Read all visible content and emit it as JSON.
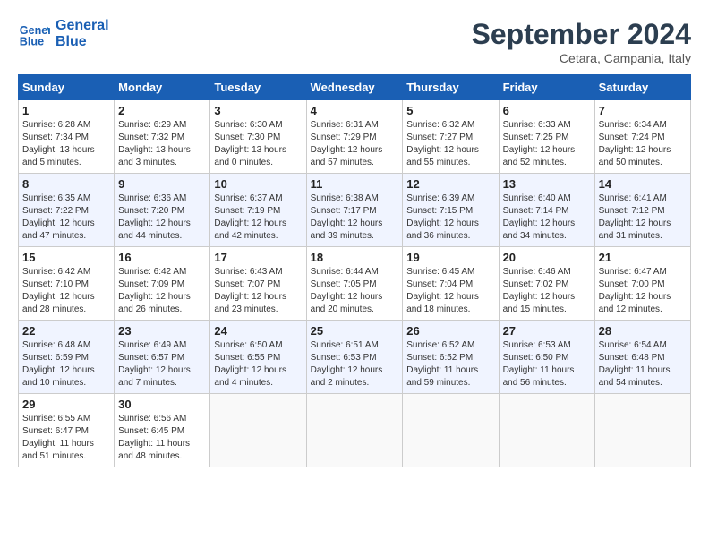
{
  "header": {
    "logo_line1": "General",
    "logo_line2": "Blue",
    "month_title": "September 2024",
    "subtitle": "Cetara, Campania, Italy"
  },
  "days_of_week": [
    "Sunday",
    "Monday",
    "Tuesday",
    "Wednesday",
    "Thursday",
    "Friday",
    "Saturday"
  ],
  "weeks": [
    [
      {
        "day": "1",
        "info": "Sunrise: 6:28 AM\nSunset: 7:34 PM\nDaylight: 13 hours and 5 minutes."
      },
      {
        "day": "2",
        "info": "Sunrise: 6:29 AM\nSunset: 7:32 PM\nDaylight: 13 hours and 3 minutes."
      },
      {
        "day": "3",
        "info": "Sunrise: 6:30 AM\nSunset: 7:30 PM\nDaylight: 13 hours and 0 minutes."
      },
      {
        "day": "4",
        "info": "Sunrise: 6:31 AM\nSunset: 7:29 PM\nDaylight: 12 hours and 57 minutes."
      },
      {
        "day": "5",
        "info": "Sunrise: 6:32 AM\nSunset: 7:27 PM\nDaylight: 12 hours and 55 minutes."
      },
      {
        "day": "6",
        "info": "Sunrise: 6:33 AM\nSunset: 7:25 PM\nDaylight: 12 hours and 52 minutes."
      },
      {
        "day": "7",
        "info": "Sunrise: 6:34 AM\nSunset: 7:24 PM\nDaylight: 12 hours and 50 minutes."
      }
    ],
    [
      {
        "day": "8",
        "info": "Sunrise: 6:35 AM\nSunset: 7:22 PM\nDaylight: 12 hours and 47 minutes."
      },
      {
        "day": "9",
        "info": "Sunrise: 6:36 AM\nSunset: 7:20 PM\nDaylight: 12 hours and 44 minutes."
      },
      {
        "day": "10",
        "info": "Sunrise: 6:37 AM\nSunset: 7:19 PM\nDaylight: 12 hours and 42 minutes."
      },
      {
        "day": "11",
        "info": "Sunrise: 6:38 AM\nSunset: 7:17 PM\nDaylight: 12 hours and 39 minutes."
      },
      {
        "day": "12",
        "info": "Sunrise: 6:39 AM\nSunset: 7:15 PM\nDaylight: 12 hours and 36 minutes."
      },
      {
        "day": "13",
        "info": "Sunrise: 6:40 AM\nSunset: 7:14 PM\nDaylight: 12 hours and 34 minutes."
      },
      {
        "day": "14",
        "info": "Sunrise: 6:41 AM\nSunset: 7:12 PM\nDaylight: 12 hours and 31 minutes."
      }
    ],
    [
      {
        "day": "15",
        "info": "Sunrise: 6:42 AM\nSunset: 7:10 PM\nDaylight: 12 hours and 28 minutes."
      },
      {
        "day": "16",
        "info": "Sunrise: 6:42 AM\nSunset: 7:09 PM\nDaylight: 12 hours and 26 minutes."
      },
      {
        "day": "17",
        "info": "Sunrise: 6:43 AM\nSunset: 7:07 PM\nDaylight: 12 hours and 23 minutes."
      },
      {
        "day": "18",
        "info": "Sunrise: 6:44 AM\nSunset: 7:05 PM\nDaylight: 12 hours and 20 minutes."
      },
      {
        "day": "19",
        "info": "Sunrise: 6:45 AM\nSunset: 7:04 PM\nDaylight: 12 hours and 18 minutes."
      },
      {
        "day": "20",
        "info": "Sunrise: 6:46 AM\nSunset: 7:02 PM\nDaylight: 12 hours and 15 minutes."
      },
      {
        "day": "21",
        "info": "Sunrise: 6:47 AM\nSunset: 7:00 PM\nDaylight: 12 hours and 12 minutes."
      }
    ],
    [
      {
        "day": "22",
        "info": "Sunrise: 6:48 AM\nSunset: 6:59 PM\nDaylight: 12 hours and 10 minutes."
      },
      {
        "day": "23",
        "info": "Sunrise: 6:49 AM\nSunset: 6:57 PM\nDaylight: 12 hours and 7 minutes."
      },
      {
        "day": "24",
        "info": "Sunrise: 6:50 AM\nSunset: 6:55 PM\nDaylight: 12 hours and 4 minutes."
      },
      {
        "day": "25",
        "info": "Sunrise: 6:51 AM\nSunset: 6:53 PM\nDaylight: 12 hours and 2 minutes."
      },
      {
        "day": "26",
        "info": "Sunrise: 6:52 AM\nSunset: 6:52 PM\nDaylight: 11 hours and 59 minutes."
      },
      {
        "day": "27",
        "info": "Sunrise: 6:53 AM\nSunset: 6:50 PM\nDaylight: 11 hours and 56 minutes."
      },
      {
        "day": "28",
        "info": "Sunrise: 6:54 AM\nSunset: 6:48 PM\nDaylight: 11 hours and 54 minutes."
      }
    ],
    [
      {
        "day": "29",
        "info": "Sunrise: 6:55 AM\nSunset: 6:47 PM\nDaylight: 11 hours and 51 minutes."
      },
      {
        "day": "30",
        "info": "Sunrise: 6:56 AM\nSunset: 6:45 PM\nDaylight: 11 hours and 48 minutes."
      },
      {
        "day": "",
        "info": ""
      },
      {
        "day": "",
        "info": ""
      },
      {
        "day": "",
        "info": ""
      },
      {
        "day": "",
        "info": ""
      },
      {
        "day": "",
        "info": ""
      }
    ]
  ]
}
